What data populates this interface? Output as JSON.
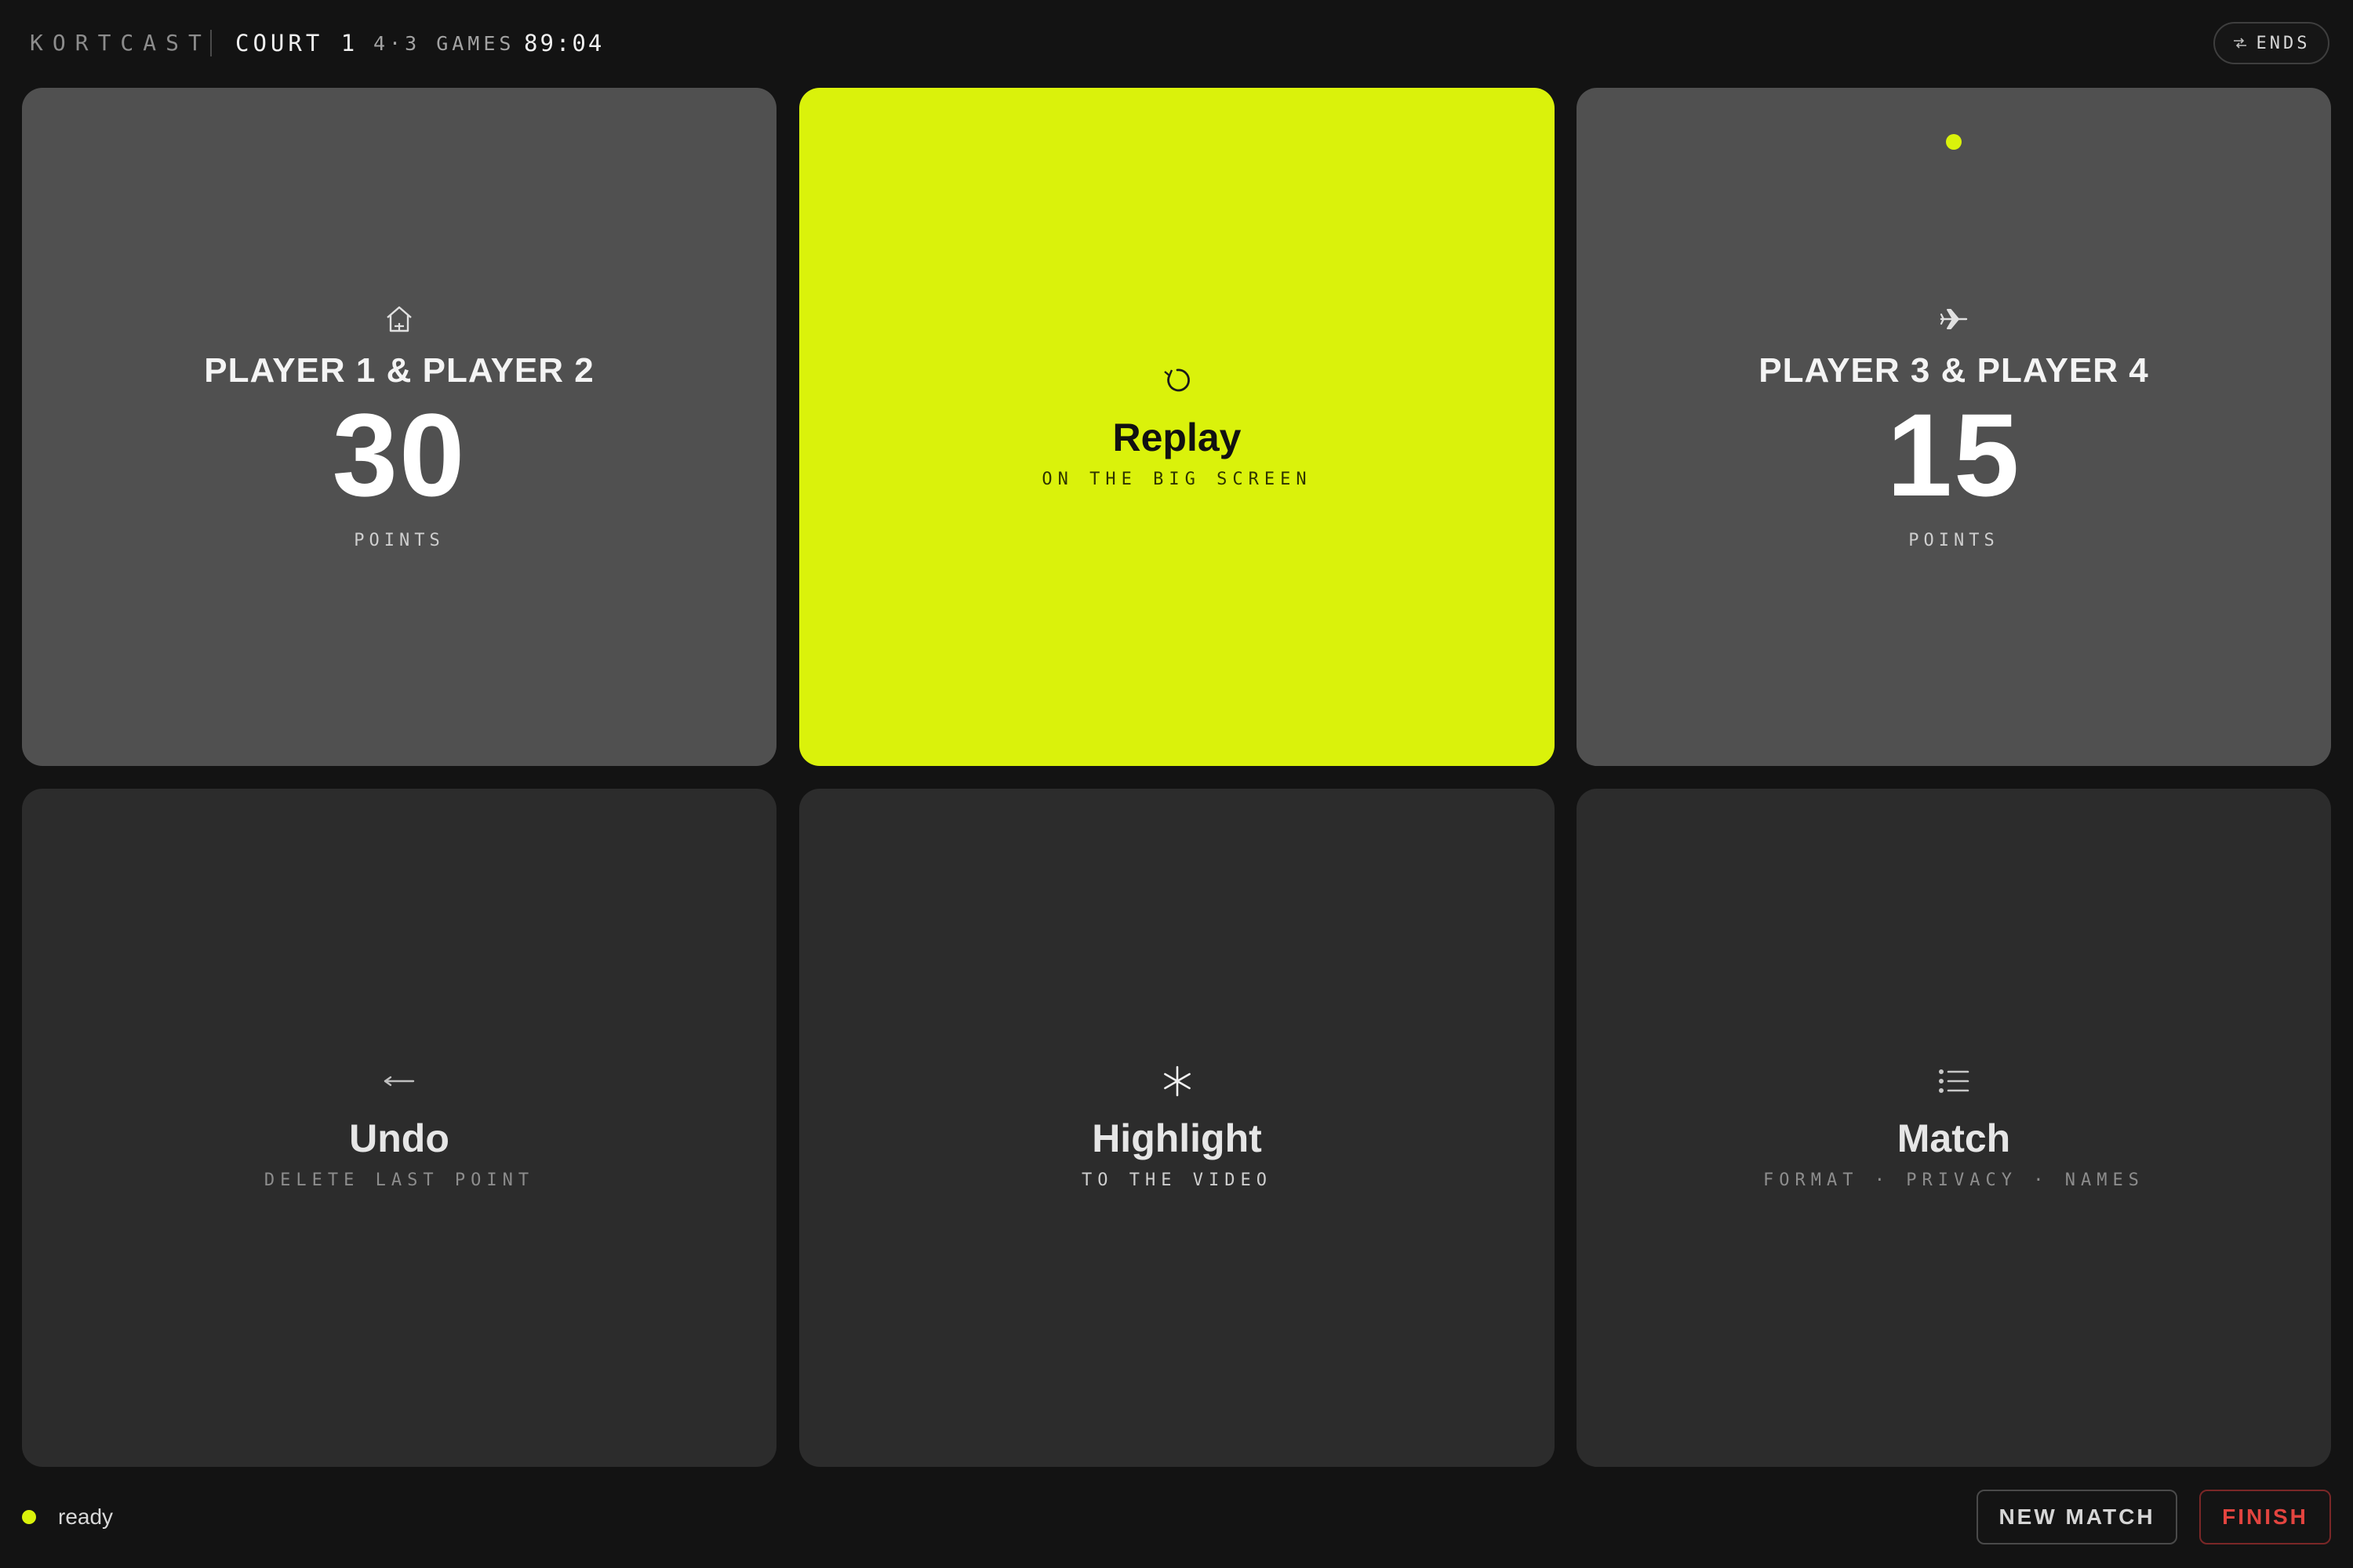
{
  "header": {
    "brand": "KORTCAST",
    "court": "COURT 1",
    "games": "4·3 GAMES",
    "clock": "89:04",
    "ends_button": {
      "label": "ENDS",
      "icon": "swap-icon"
    }
  },
  "tiles": {
    "team1": {
      "icon": "home-icon",
      "name": "PLAYER 1 & PLAYER 2",
      "score": "30",
      "unit": "POINTS"
    },
    "replay": {
      "icon": "replay-icon",
      "title": "Replay",
      "subtitle": "ON THE BIG SCREEN",
      "background": "#daf20b"
    },
    "team2": {
      "icon": "plane-icon",
      "name": "PLAYER 3 & PLAYER 4",
      "score": "15",
      "unit": "POINTS",
      "serving": true
    },
    "undo": {
      "icon": "back-arrow-icon",
      "title": "Undo",
      "subtitle": "DELETE LAST POINT"
    },
    "highlight": {
      "icon": "asterisk-icon",
      "title": "Highlight",
      "subtitle": "TO THE VIDEO"
    },
    "match": {
      "icon": "list-icon",
      "title": "Match",
      "subtitle": "FORMAT · PRIVACY · NAMES"
    }
  },
  "footer": {
    "status": "ready",
    "new_match_label": "NEW MATCH",
    "finish_label": "FINISH"
  },
  "colors": {
    "accent": "#daf20b",
    "background": "#131313",
    "team_tile": "#505050",
    "action_tile": "#2c2c2c",
    "danger": "#e3443f"
  }
}
